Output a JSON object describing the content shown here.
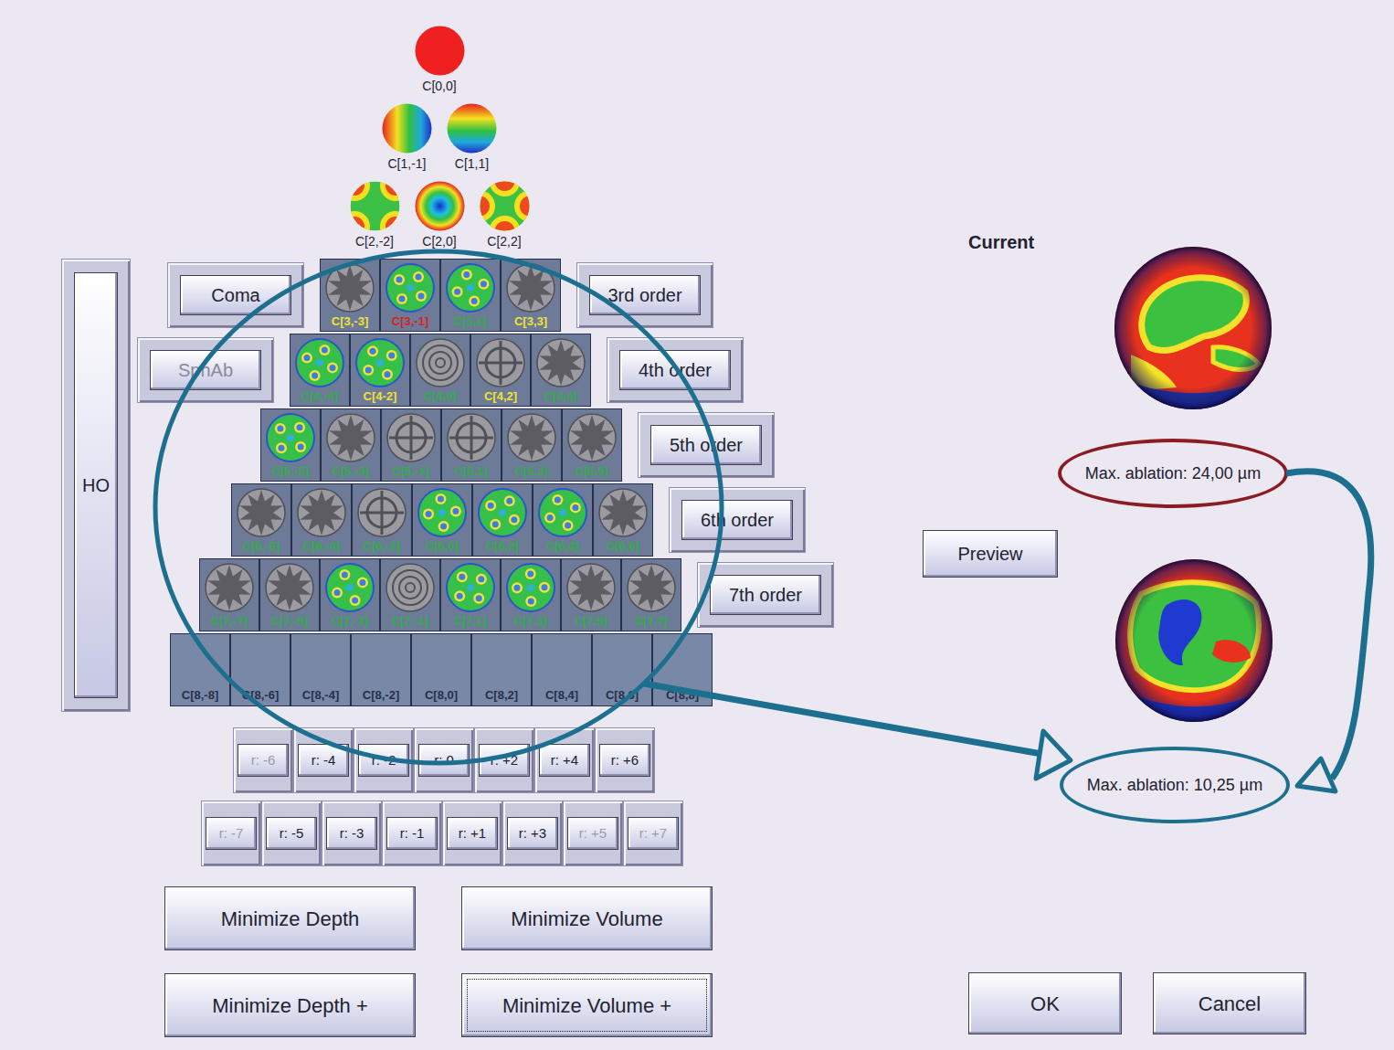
{
  "low_order": [
    [
      {
        "label": "C[0,0]",
        "kind": "piston"
      }
    ],
    [
      {
        "label": "C[1,-1]",
        "kind": "tilt-x"
      },
      {
        "label": "C[1,1]",
        "kind": "tilt-y"
      }
    ],
    [
      {
        "label": "C[2,-2]",
        "kind": "astig-oblique"
      },
      {
        "label": "C[2,0]",
        "kind": "defocus"
      },
      {
        "label": "C[2,2]",
        "kind": "astig-vertical"
      }
    ]
  ],
  "ho_button": {
    "label": "HO"
  },
  "high_order_rows": [
    {
      "left": {
        "label": "Coma",
        "disabled": false
      },
      "right": "3rd order",
      "tiles": [
        {
          "label": "C[3,-3]",
          "kind": "star",
          "color": "#f2e230"
        },
        {
          "label": "C[3,-1]",
          "kind": "map",
          "color": "#d8201e"
        },
        {
          "label": "C[3,1]",
          "kind": "map",
          "color": "#2fae4a"
        },
        {
          "label": "C[3,3]",
          "kind": "star",
          "color": "#f2e230"
        }
      ]
    },
    {
      "left": {
        "label": "SphAb",
        "disabled": true
      },
      "right": "4th order",
      "tiles": [
        {
          "label": "C[4,-4]",
          "kind": "map",
          "color": "#2fae4a"
        },
        {
          "label": "C[4-2]",
          "kind": "map",
          "color": "#f2e230"
        },
        {
          "label": "C[4,0]",
          "kind": "rings",
          "color": "#2fae4a"
        },
        {
          "label": "C[4,2]",
          "kind": "cross",
          "color": "#f2e230"
        },
        {
          "label": "C[4,4]",
          "kind": "star",
          "color": "#2fae4a"
        }
      ]
    },
    {
      "right": "5th order",
      "tiles": [
        {
          "label": "C[5,-5]",
          "kind": "map",
          "color": "#2fae4a"
        },
        {
          "label": "C[5,-3]",
          "kind": "star",
          "color": "#2fae4a"
        },
        {
          "label": "C[5,-1]",
          "kind": "cross",
          "color": "#2fae4a"
        },
        {
          "label": "C[5,1]",
          "kind": "cross",
          "color": "#2fae4a"
        },
        {
          "label": "C[5,3]",
          "kind": "star",
          "color": "#2fae4a"
        },
        {
          "label": "C[5,5]",
          "kind": "star",
          "color": "#2fae4a"
        }
      ]
    },
    {
      "right": "6th order",
      "tiles": [
        {
          "label": "C[6,-6]",
          "kind": "star",
          "color": "#2fae4a"
        },
        {
          "label": "C[6,-4]",
          "kind": "star",
          "color": "#2fae4a"
        },
        {
          "label": "C[6,-2]",
          "kind": "cross",
          "color": "#2fae4a"
        },
        {
          "label": "C[6,0]",
          "kind": "map",
          "color": "#2fae4a"
        },
        {
          "label": "C[6,2]",
          "kind": "map",
          "color": "#2fae4a"
        },
        {
          "label": "C[6,4]",
          "kind": "map",
          "color": "#2fae4a"
        },
        {
          "label": "C[6,6]",
          "kind": "star",
          "color": "#2fae4a"
        }
      ]
    },
    {
      "right": "7th order",
      "tiles": [
        {
          "label": "C[7,-7]",
          "kind": "star",
          "color": "#2fae4a"
        },
        {
          "label": "C[7,-5]",
          "kind": "star",
          "color": "#2fae4a"
        },
        {
          "label": "C[7,-3]",
          "kind": "map",
          "color": "#2fae4a"
        },
        {
          "label": "C[7,-1]",
          "kind": "rings",
          "color": "#2fae4a"
        },
        {
          "label": "C[7,1]",
          "kind": "map",
          "color": "#2fae4a"
        },
        {
          "label": "C[7,3]",
          "kind": "map",
          "color": "#2fae4a"
        },
        {
          "label": "C[7,5]",
          "kind": "star",
          "color": "#2fae4a"
        },
        {
          "label": "C[7,7]",
          "kind": "star",
          "color": "#2fae4a"
        }
      ]
    },
    {
      "tiles": [
        {
          "label": "C[8,-8]",
          "kind": "empty",
          "color": "#26304c"
        },
        {
          "label": "C[8,-6]",
          "kind": "empty",
          "color": "#26304c"
        },
        {
          "label": "C[8,-4]",
          "kind": "empty",
          "color": "#26304c"
        },
        {
          "label": "C[8,-2]",
          "kind": "empty",
          "color": "#26304c"
        },
        {
          "label": "C[8,0]",
          "kind": "empty",
          "color": "#26304c"
        },
        {
          "label": "C[8,2]",
          "kind": "empty",
          "color": "#26304c"
        },
        {
          "label": "C[8,4]",
          "kind": "empty",
          "color": "#26304c"
        },
        {
          "label": "C[8,6]",
          "kind": "empty",
          "color": "#26304c"
        },
        {
          "label": "C[8,8]",
          "kind": "empty",
          "color": "#26304c"
        }
      ]
    }
  ],
  "r_rows": [
    [
      {
        "label": "r: -6",
        "disabled": true
      },
      {
        "label": "r: -4",
        "disabled": false
      },
      {
        "label": "r: -2",
        "disabled": false
      },
      {
        "label": "r: 0",
        "disabled": false
      },
      {
        "label": "r: +2",
        "disabled": false
      },
      {
        "label": "r: +4",
        "disabled": false
      },
      {
        "label": "r: +6",
        "disabled": false
      }
    ],
    [
      {
        "label": "r: -7",
        "disabled": true
      },
      {
        "label": "r: -5",
        "disabled": false
      },
      {
        "label": "r: -3",
        "disabled": false
      },
      {
        "label": "r: -1",
        "disabled": false
      },
      {
        "label": "r: +1",
        "disabled": false
      },
      {
        "label": "r: +3",
        "disabled": false
      },
      {
        "label": "r: +5",
        "disabled": true
      },
      {
        "label": "r: +7",
        "disabled": true
      }
    ]
  ],
  "minimize_buttons": [
    {
      "label": "Minimize Depth",
      "focused": false
    },
    {
      "label": "Minimize Volume",
      "focused": false
    },
    {
      "label": "Minimize Depth +",
      "focused": false
    },
    {
      "label": "Minimize Volume +",
      "focused": true
    }
  ],
  "preview_panel": {
    "title": "Current",
    "current_max_ablation": "Max. ablation: 24,00 µm",
    "preview_button": "Preview",
    "preview_max_ablation": "Max. ablation: 10,25 µm"
  },
  "dialog_buttons": [
    "OK",
    "Cancel"
  ]
}
